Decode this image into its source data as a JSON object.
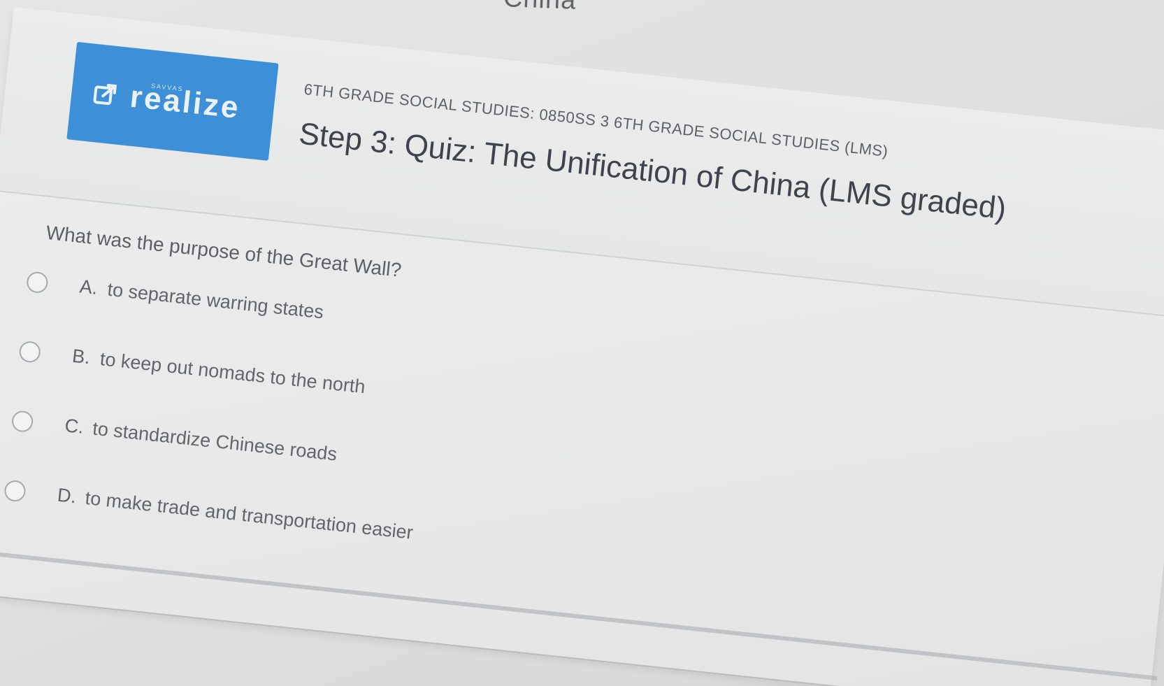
{
  "page": {
    "top_title": "China"
  },
  "header": {
    "logo_text": "realize",
    "logo_small_text": "SAVVAS",
    "course_line": "6TH GRADE SOCIAL STUDIES: 0850SS 3 6TH GRADE SOCIAL STUDIES (LMS)",
    "quiz_title": "Step 3: Quiz: The Unification of China (LMS graded)"
  },
  "question": {
    "prompt": "What was the purpose of the Great Wall?",
    "options": [
      {
        "letter": "A.",
        "text": "to separate warring states"
      },
      {
        "letter": "B.",
        "text": "to keep out nomads to the north"
      },
      {
        "letter": "C.",
        "text": "to standardize Chinese roads"
      },
      {
        "letter": "D.",
        "text": "to make trade and transportation easier"
      }
    ]
  },
  "colors": {
    "brand_blue": "#3d8fd8",
    "text_dark": "#3e444b"
  },
  "icons": {
    "logo_icon": "external-link-icon"
  }
}
